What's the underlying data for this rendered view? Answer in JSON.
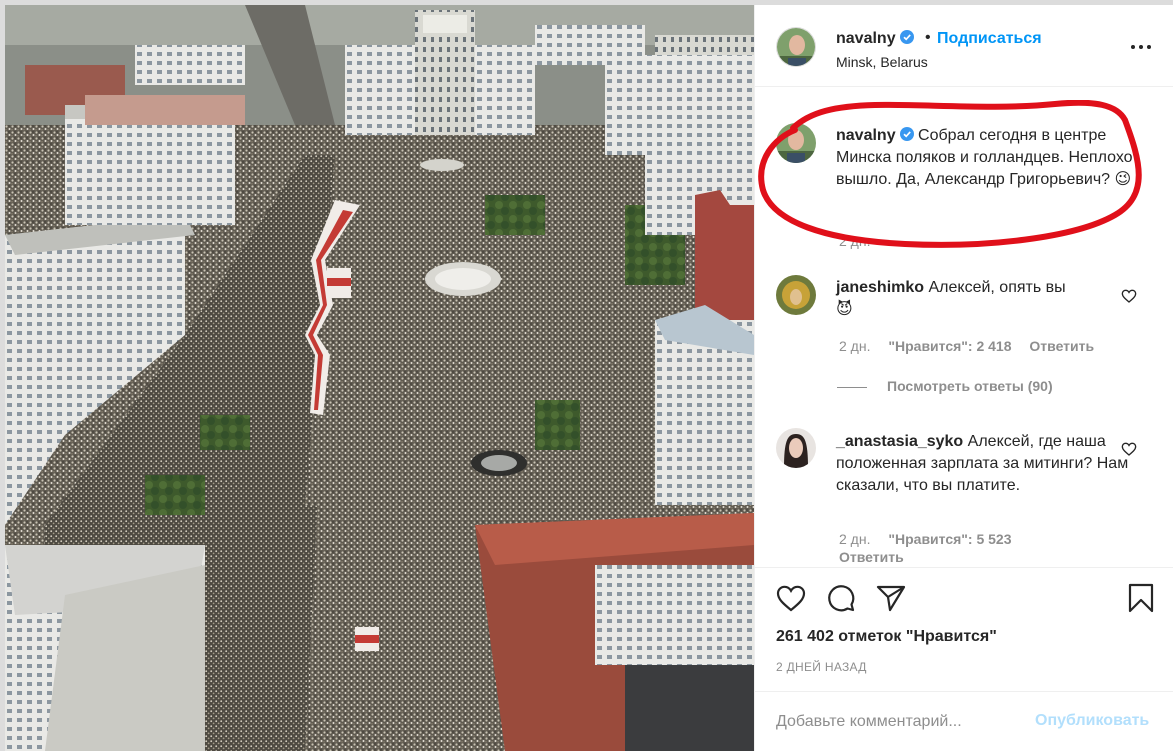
{
  "post": {
    "username": "navalny",
    "follow_label": "Подписаться",
    "dot": "•",
    "location": "Minsk, Belarus",
    "more_icon": "more-horizontal-icon"
  },
  "caption": {
    "username": "navalny",
    "text": "Собрал сегодня в центре Минска поляков и голландцев. Неплохо вышло. Да, Александр Григорьевич?",
    "emoji": "😉",
    "time": "2 дн."
  },
  "comments": [
    {
      "username": "janeshimko",
      "text": "Алексей, опять вы",
      "emoji": "😈",
      "time": "2 дн.",
      "likes": "\"Нравится\": 2 418",
      "reply_label": "Ответить",
      "view_replies": "Посмотреть ответы (90)"
    },
    {
      "username": "_anastasia_syko",
      "text": "Алексей, где наша положенная зарплата за митинги? Нам сказали, что вы платите.",
      "time": "2 дн.",
      "likes": "\"Нравится\": 5 523",
      "reply_label": "Ответить"
    }
  ],
  "actions": {
    "likes_count": "261 402 отметок \"Нравится\"",
    "date": "2 ДНЕЙ НАЗАД"
  },
  "add_comment": {
    "placeholder": "Добавьте комментарий...",
    "publish_label": "Опубликовать"
  },
  "colors": {
    "link_blue": "#0095f6",
    "publish_disabled": "#b2dffc",
    "annotation_red": "#e0101a",
    "muted": "#8e8e8e"
  }
}
